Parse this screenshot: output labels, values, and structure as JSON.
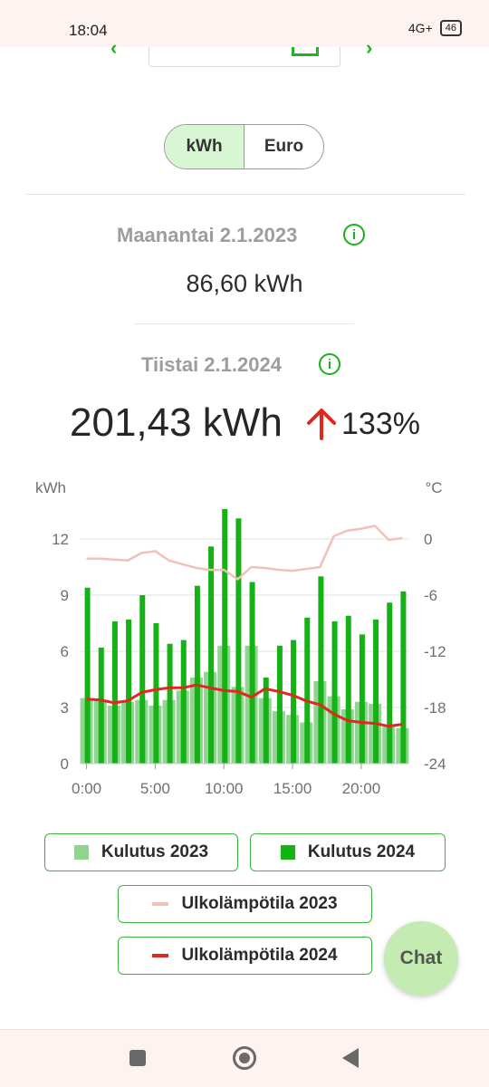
{
  "status_bar": {
    "time": "18:04",
    "network": "4G+",
    "battery": "46"
  },
  "units_toggle": {
    "options": [
      "kWh",
      "Euro"
    ],
    "selected": "kWh"
  },
  "previous": {
    "day": "Maanantai 2.1.2023",
    "value": "86,60 kWh"
  },
  "current": {
    "day": "Tiistai 2.1.2024",
    "value": "201,43 kWh",
    "change": "133%",
    "direction": "up"
  },
  "chart_data": {
    "type": "bar",
    "y_left_label": "kWh",
    "y_right_label": "°C",
    "y_left_ticks": [
      "0",
      "3",
      "6",
      "9",
      "12"
    ],
    "y_right_ticks": [
      "-24",
      "-18",
      "-12",
      "-6",
      "0"
    ],
    "x_ticks": [
      "0:00",
      "5:00",
      "10:00",
      "15:00",
      "20:00"
    ],
    "ylim": [
      0,
      12
    ],
    "temp_lim": [
      -24,
      0
    ],
    "hours": [
      0,
      1,
      2,
      3,
      4,
      5,
      6,
      7,
      8,
      9,
      10,
      11,
      12,
      13,
      14,
      15,
      16,
      17,
      18,
      19,
      20,
      21,
      22,
      23
    ],
    "series": [
      {
        "name": "Kulutus 2023",
        "color": "#8fd48f",
        "values": [
          3.5,
          3.4,
          3.1,
          3.3,
          3.4,
          3.1,
          3.4,
          3.9,
          4.6,
          4.9,
          6.3,
          4.1,
          6.3,
          3.5,
          2.8,
          2.6,
          2.2,
          4.4,
          3.6,
          2.9,
          3.3,
          3.2,
          2.0,
          1.9
        ]
      },
      {
        "name": "Kulutus 2024",
        "color": "#14b214",
        "values": [
          9.4,
          6.2,
          7.6,
          7.7,
          9.0,
          7.5,
          6.4,
          6.6,
          9.5,
          11.6,
          13.6,
          13.1,
          9.7,
          4.6,
          6.3,
          6.6,
          7.8,
          10.0,
          7.6,
          7.9,
          6.9,
          7.7,
          8.6,
          9.2
        ]
      },
      {
        "name": "Ulkolämpötila 2023",
        "color": "#f2bfb9",
        "values": [
          -2.1,
          -2.1,
          -2.2,
          -2.3,
          -1.5,
          -1.3,
          -2.3,
          -2.7,
          -3.1,
          -3.3,
          -3.3,
          -4.3,
          -3.0,
          -3.1,
          -3.3,
          -3.4,
          -3.2,
          -3.0,
          0.3,
          0.9,
          1.1,
          1.4,
          -0.1,
          0.1
        ]
      },
      {
        "name": "Ulkolämpötila 2024",
        "color": "#e0281e",
        "values": [
          -17.1,
          -17.2,
          -17.5,
          -17.3,
          -16.4,
          -16.1,
          -15.9,
          -15.9,
          -15.6,
          -15.9,
          -16.2,
          -16.3,
          -16.9,
          -16.0,
          -16.3,
          -16.7,
          -17.3,
          -17.7,
          -18.7,
          -19.4,
          -19.6,
          -19.7,
          -20.0,
          -19.8
        ]
      }
    ]
  },
  "legend": [
    {
      "label": "Kulutus 2023",
      "color": "#8fd48f",
      "kind": "square"
    },
    {
      "label": "Kulutus 2024",
      "color": "#14b214",
      "kind": "square"
    },
    {
      "label": "Ulkolämpötila 2023",
      "color": "#f2bfb9",
      "kind": "line"
    },
    {
      "label": "Ulkolämpötila 2024",
      "color": "#e0281e",
      "kind": "line"
    }
  ],
  "chat": {
    "label": "Chat"
  }
}
